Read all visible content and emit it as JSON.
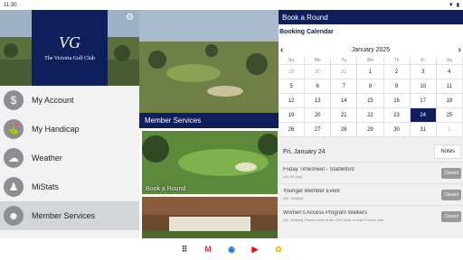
{
  "status": {
    "time": "11:30"
  },
  "club": {
    "mark": "VG",
    "name": "The Victoria Golf Club"
  },
  "menu": {
    "items": [
      {
        "label": "My Account",
        "icon": "dollar-icon"
      },
      {
        "label": "My Handicap",
        "icon": "golfer-icon"
      },
      {
        "label": "Weather",
        "icon": "weather-icon"
      },
      {
        "label": "MiStats",
        "icon": "stats-icon"
      },
      {
        "label": "Member Services",
        "icon": "members-icon",
        "active": true
      }
    ]
  },
  "middle": {
    "section_title": "Member Services",
    "tile1_label": "Book a Round"
  },
  "right": {
    "header": "Book a Round",
    "calendar_title": "Booking Calendar",
    "month": "January 2025",
    "dow": [
      "Su",
      "Mo",
      "Tu",
      "We",
      "Th",
      "Fr",
      "Sa"
    ],
    "weeks": [
      [
        {
          "d": "29",
          "m": true
        },
        {
          "d": "30",
          "m": true
        },
        {
          "d": "31",
          "m": true
        },
        {
          "d": "1"
        },
        {
          "d": "2"
        },
        {
          "d": "3"
        },
        {
          "d": "4"
        }
      ],
      [
        {
          "d": "5"
        },
        {
          "d": "6"
        },
        {
          "d": "7"
        },
        {
          "d": "8"
        },
        {
          "d": "9"
        },
        {
          "d": "10"
        },
        {
          "d": "11"
        }
      ],
      [
        {
          "d": "12"
        },
        {
          "d": "13"
        },
        {
          "d": "14"
        },
        {
          "d": "15"
        },
        {
          "d": "16"
        },
        {
          "d": "17"
        },
        {
          "d": "18"
        }
      ],
      [
        {
          "d": "19"
        },
        {
          "d": "20"
        },
        {
          "d": "21"
        },
        {
          "d": "22"
        },
        {
          "d": "23"
        },
        {
          "d": "24",
          "s": true
        },
        {
          "d": "25"
        }
      ],
      [
        {
          "d": "26"
        },
        {
          "d": "27"
        },
        {
          "d": "28"
        },
        {
          "d": "29"
        },
        {
          "d": "30"
        },
        {
          "d": "31"
        },
        {
          "d": "1",
          "m": true
        }
      ]
    ],
    "selected_date": "Fri, January 24",
    "notes_label": "Notes",
    "events": [
      {
        "title": "Friday Timesheet - Stableford",
        "sub": "[All, All Day]",
        "status": "Closed"
      },
      {
        "title": "Younger Member Event",
        "sub": "[All, Twilight]",
        "status": "Closed"
      },
      {
        "title": "Women's Access Program Walkers",
        "sub2": "[All, Twilight] Please meet at the Golf Shop to walk 9 holes with",
        "status": "Closed"
      }
    ]
  },
  "colors": {
    "navy": "#0e1f5b",
    "active": "#d3d5d8"
  }
}
